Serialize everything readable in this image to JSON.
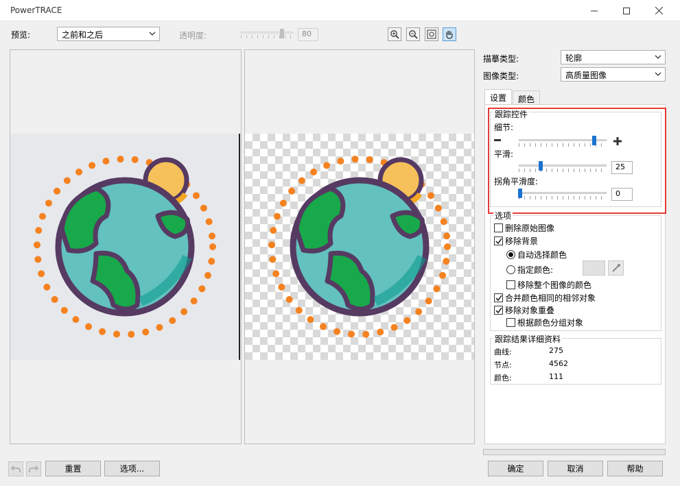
{
  "window": {
    "title": "PowerTRACE"
  },
  "toolbar": {
    "preview_label": "预览:",
    "preview_value": "之前和之后",
    "transparency_label": "透明度:",
    "transparency_value": "80"
  },
  "right": {
    "trace_type_label": "描摹类型:",
    "trace_type_value": "轮廓",
    "image_type_label": "图像类型:",
    "image_type_value": "高质量图像",
    "tabs": [
      "设置",
      "颜色"
    ],
    "trace_controls": {
      "title": "跟踪控件",
      "detail_label": "细节:",
      "detail_level": 0.86,
      "smoothing_label": "平滑:",
      "smoothing_value": "25",
      "corner_label": "拐角平滑度:",
      "corner_value": "0"
    },
    "options": {
      "title": "选项",
      "delete_original": "删除原始图像",
      "remove_background": "移除背景",
      "auto_color": "自动选择颜色",
      "specify_color": "指定颜色:",
      "remove_color_entire": "移除整个图像的颜色",
      "merge_adjacent": "合并颜色相同的相邻对象",
      "remove_overlap": "移除对象重叠",
      "group_by_color": "根据颜色分组对象"
    },
    "results": {
      "title": "跟踪结果详细资料",
      "curves_label": "曲线:",
      "curves_value": "275",
      "nodes_label": "节点:",
      "nodes_value": "4562",
      "colors_label": "颜色:",
      "colors_value": "111"
    }
  },
  "bottom": {
    "reset": "重置",
    "options": "选项...",
    "ok": "确定",
    "cancel": "取消",
    "help": "帮助"
  },
  "colors": {
    "highlight": "#e53935",
    "accent": "#1b73d1",
    "ocean": "#63c1be",
    "land": "#17a94a",
    "outline": "#563a62",
    "sun": "#f6c15a",
    "dots": "#f58220"
  }
}
